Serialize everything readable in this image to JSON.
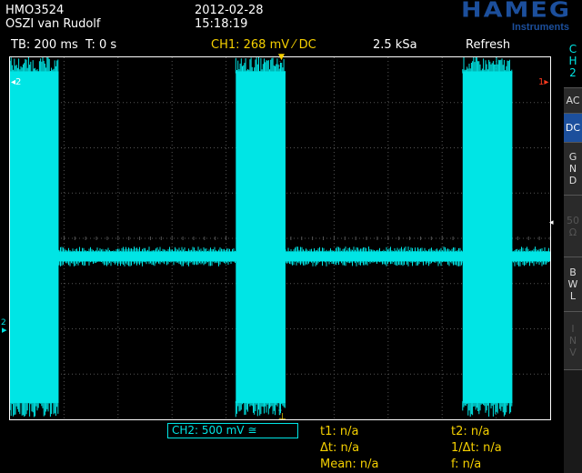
{
  "header": {
    "model": "HMO3524",
    "name": "OSZI van Rudolf",
    "date": "2012-02-28",
    "time": "15:18:19"
  },
  "logo": {
    "brand": "HAMEG",
    "sub": "Instruments",
    "color": "#1c4f9c"
  },
  "status": {
    "timebase": "TB: 200 ms",
    "trigger_time": "T: 0 s",
    "ch1_trigger": "CH1: 268 mV ⁄ DC",
    "sample_rate": "2.5 kSa",
    "mode": "Refresh"
  },
  "side_menu": {
    "channel_label": [
      "C",
      "H",
      "2"
    ],
    "buttons": [
      {
        "lines": [
          "AC"
        ],
        "state": "normal"
      },
      {
        "lines": [
          "DC"
        ],
        "state": "active"
      },
      {
        "lines": [
          "G",
          "N",
          "D"
        ],
        "state": "normal"
      },
      {
        "lines": [
          "50",
          "Ω"
        ],
        "state": "disabled"
      },
      {
        "lines": [
          "B",
          "W",
          "L"
        ],
        "state": "normal"
      },
      {
        "lines": [
          "I",
          "N",
          "V"
        ],
        "state": "disabled"
      }
    ]
  },
  "markers": {
    "ch2_left": "2",
    "ch1_right": "1"
  },
  "channel_box": {
    "ch2": "CH2: 500 mV ≅"
  },
  "cursors": {
    "t1": "t1: n/a",
    "t2": "t2: n/a",
    "dt": "Δt: n/a",
    "inv_dt": "1/Δt: n/a",
    "mean": "Mean: n/a",
    "f": "f: n/a"
  },
  "colors": {
    "ch1": "#f5d000",
    "ch2": "#00e5e5",
    "grid": "#555555",
    "active_button": "#1c4f9c"
  },
  "trace": {
    "bursts": [
      {
        "start_div": 0.0,
        "end_div": 0.9
      },
      {
        "start_div": 4.18,
        "end_div": 5.1
      },
      {
        "start_div": 8.38,
        "end_div": 9.3
      }
    ],
    "burst_top_div": 0.15,
    "burst_bottom_div": 7.8,
    "baseline_div": 4.4,
    "baseline_noise_div": 0.22
  }
}
